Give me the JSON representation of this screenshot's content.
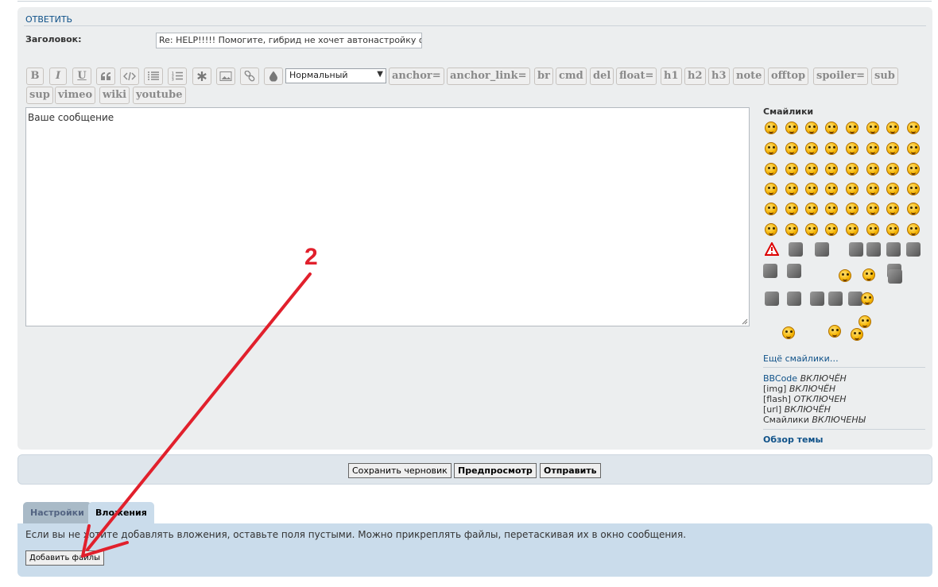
{
  "colors": {
    "accent_red": "#e1202c",
    "link_blue": "#105289",
    "panel_bg": "#eceeef",
    "tab_bg": "#cadceb"
  },
  "reply": {
    "heading": "ОТВЕТИТЬ",
    "subject_label": "Заголовок:",
    "subject_value": "Re: HELP!!!!! Помогите, гибрид не хочет автонастройку од"
  },
  "toolbar": {
    "icon_buttons": [
      {
        "name": "bold-button",
        "glyph": "B"
      },
      {
        "name": "italic-button",
        "glyph": "I"
      },
      {
        "name": "underline-button",
        "glyph": "U"
      },
      {
        "name": "quote-button",
        "icon": "quote-icon"
      },
      {
        "name": "code-button",
        "icon": "code-icon"
      },
      {
        "name": "list-button",
        "icon": "list-icon"
      },
      {
        "name": "ordered-list-button",
        "icon": "ordered-list-icon"
      },
      {
        "name": "list-item-button",
        "icon": "asterisk-icon"
      },
      {
        "name": "image-button",
        "icon": "image-icon"
      },
      {
        "name": "url-button",
        "icon": "link-icon"
      },
      {
        "name": "color-button",
        "icon": "droplet-icon"
      }
    ],
    "font_size_value": "Нормальный",
    "tags_row1": [
      "anchor=",
      "anchor_link=",
      "br",
      "cmd",
      "del",
      "float=",
      "h1",
      "h2",
      "h3",
      "note",
      "offtop",
      "spoiler=",
      "sub"
    ],
    "tags_row2": [
      "sup",
      "vimeo",
      "wiki",
      "youtube"
    ]
  },
  "message": {
    "placeholder": "Ваше сообщение"
  },
  "smilies": {
    "title": "Смайлики",
    "more_link": "Ещё смайлики…",
    "tool_icons": [
      "warning-icon",
      "engine-icon",
      "circuit-board-icon",
      "beer-mug-icon",
      "hammer-icon",
      "screwdriver-icon",
      "wrench-icon",
      "pliers-icon",
      "phone-icon",
      "chainsaw-icon",
      "spark-plug-icon",
      "magnifier-icon",
      "drill-icon",
      "bulb-icon",
      "key-icon",
      "trumpet-icon"
    ]
  },
  "status": [
    {
      "label": "BBCode",
      "state": "ВКЛЮЧЁН"
    },
    {
      "label": "[img]",
      "state": "ВКЛЮЧЁН"
    },
    {
      "label": "[flash]",
      "state": "ОТКЛЮЧЕН"
    },
    {
      "label": "[url]",
      "state": "ВКЛЮЧЁН"
    },
    {
      "label": "Смайлики",
      "state": "ВКЛЮЧЕНЫ"
    }
  ],
  "topic_review": "Обзор темы",
  "buttons": {
    "save_draft": "Сохранить черновик",
    "preview": "Предпросмотр",
    "submit": "Отправить"
  },
  "tabs": [
    "Настройки",
    "Вложения"
  ],
  "attachments": {
    "info": "Если вы не хотите добавлять вложения, оставьте поля пустыми. Можно прикреплять файлы, перетаскивая их в окно сообщения.",
    "add_files": "Добавить файлы"
  },
  "annotation": {
    "number": "2"
  }
}
